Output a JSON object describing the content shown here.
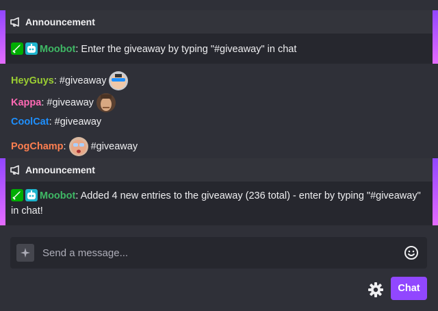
{
  "colors": {
    "accent": "#9147ff",
    "moderator_badge": "#00ad03",
    "bot_badge": "#1fb5ce"
  },
  "announcements": [
    {
      "header": "Announcement",
      "user": "Moobot",
      "user_color": "#3fb865",
      "message": ": Enter the giveaway by typing \"#giveaway\" in chat"
    },
    {
      "header": "Announcement",
      "user": "Moobot",
      "user_color": "#3fb865",
      "message": ": Added 4 new entries to the giveaway (236 total) - enter by typing \"#giveaway\" in chat!"
    }
  ],
  "messages": [
    {
      "user": "HeyGuys",
      "user_color": "#9acd32",
      "pre": ": #giveaway",
      "emote": "HeyGuys",
      "post": ""
    },
    {
      "user": "Kappa",
      "user_color": "#ff69b4",
      "pre": ": #giveaway",
      "emote": "Kappa",
      "post": ""
    },
    {
      "user": "CoolCat",
      "user_color": "#1e90ff",
      "pre": ": #giveaway",
      "emote": "",
      "post": ""
    },
    {
      "user": "PogChamp",
      "user_color": "#ff7f50",
      "pre": ":",
      "emote": "PogChamp",
      "post": "#giveaway"
    }
  ],
  "input": {
    "placeholder": "Send a message..."
  },
  "chat_button_label": "Chat",
  "icons": {
    "announcement": "megaphone-icon",
    "moderator": "sword-icon",
    "bot": "robot-icon",
    "sparkle": "sparkle-icon",
    "emoji": "smiley-icon",
    "settings": "gear-icon"
  }
}
